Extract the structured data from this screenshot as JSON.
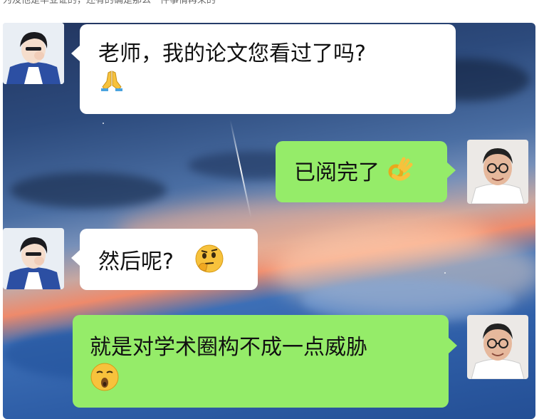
{
  "caption_cut": "为及他是毕业证的，还有的确是那么一件事情再来的",
  "messages": [
    {
      "sender": "student",
      "side": "left",
      "text": "老师，我的论文您看过了吗?",
      "emoji": "folded-hands-icon"
    },
    {
      "sender": "teacher",
      "side": "right",
      "text": "已阅完了",
      "emoji": "ok-hand-icon"
    },
    {
      "sender": "student",
      "side": "left",
      "text": "然后呢?",
      "emoji": "thinking-face-icon"
    },
    {
      "sender": "teacher",
      "side": "right",
      "text": "就是对学术圈构不成一点威胁",
      "emoji": "whistling-face-icon"
    }
  ],
  "colors": {
    "incoming_bubble": "#ffffff",
    "outgoing_bubble": "#95ec69"
  }
}
